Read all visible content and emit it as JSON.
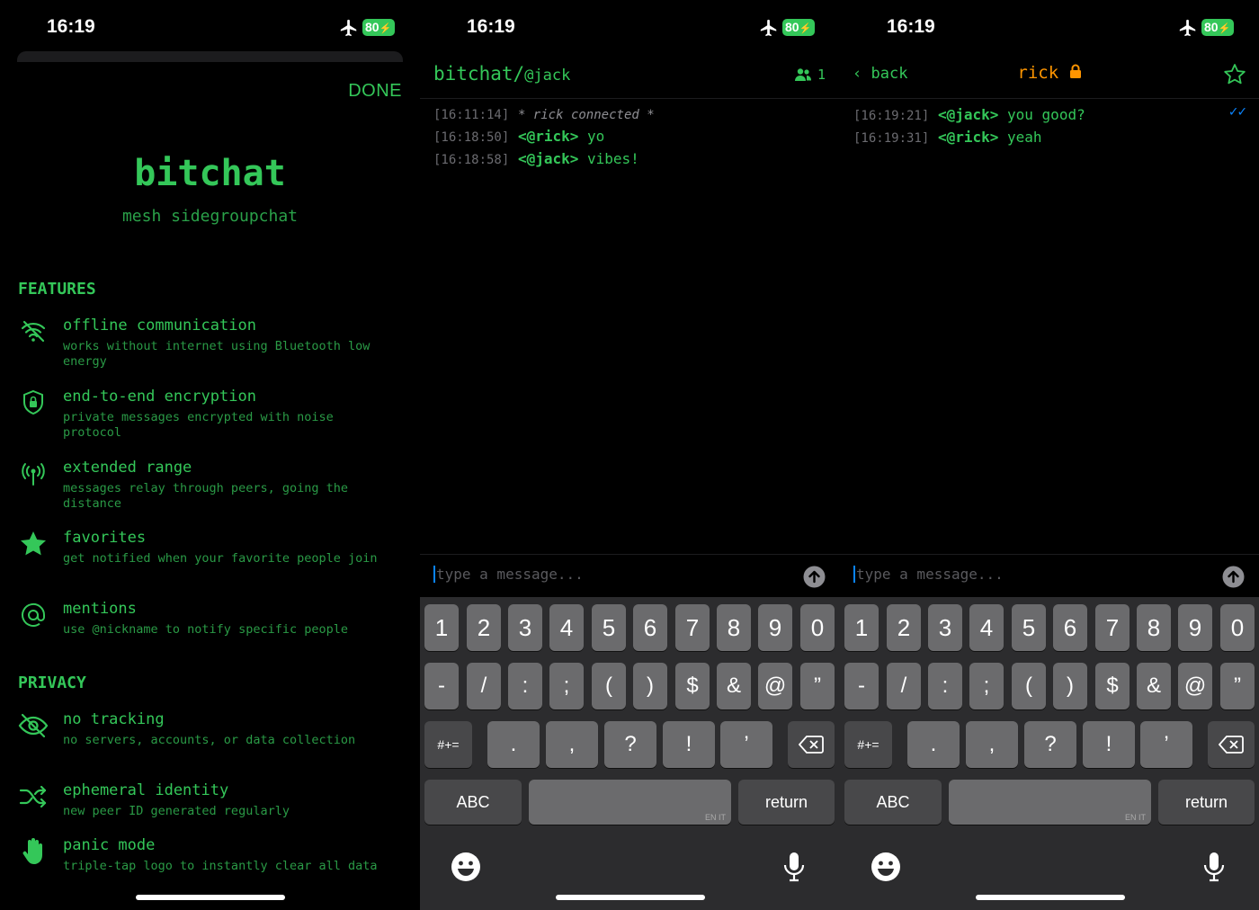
{
  "status_bar": {
    "time": "16:19",
    "battery": "80"
  },
  "about": {
    "done_label": "DONE",
    "title": "bitchat",
    "subtitle": "mesh sidegroupchat",
    "features_heading": "FEATURES",
    "features": [
      {
        "icon": "wifi-slash-icon",
        "title": "offline communication",
        "desc": "works without internet using Bluetooth low energy"
      },
      {
        "icon": "lock-shield-icon",
        "title": "end-to-end encryption",
        "desc": "private messages encrypted with noise protocol"
      },
      {
        "icon": "antenna-icon",
        "title": "extended range",
        "desc": "messages relay through peers, going the distance"
      },
      {
        "icon": "star-icon",
        "title": "favorites",
        "desc": "get notified when your favorite people join"
      },
      {
        "icon": "at-icon",
        "title": "mentions",
        "desc": "use @nickname to notify specific people"
      }
    ],
    "privacy_heading": "PRIVACY",
    "privacy": [
      {
        "icon": "eye-slash-icon",
        "title": "no tracking",
        "desc": "no servers, accounts, or data collection"
      },
      {
        "icon": "shuffle-icon",
        "title": "ephemeral identity",
        "desc": "new peer ID generated regularly"
      },
      {
        "icon": "hand-icon",
        "title": "panic mode",
        "desc": "triple-tap logo to instantly clear all data"
      }
    ]
  },
  "public_chat": {
    "title_prefix": "bitchat/",
    "nickname": "@jack",
    "peer_count": "1",
    "messages": [
      {
        "ts": "[16:11:14]",
        "system": "* rick connected *"
      },
      {
        "ts": "[16:18:50]",
        "sender": "<@rick>",
        "text": "yo"
      },
      {
        "ts": "[16:18:58]",
        "sender": "<@jack>",
        "text": "vibes!"
      }
    ]
  },
  "private_chat": {
    "back_label": "back",
    "peer_name": "rick",
    "messages": [
      {
        "ts": "[16:19:21]",
        "sender": "<@jack>",
        "text": "you good?"
      },
      {
        "ts": "[16:19:31]",
        "sender": "<@rick>",
        "text": "yeah"
      }
    ],
    "read_receipt": "✓✓"
  },
  "input": {
    "placeholder": "type a message..."
  },
  "keyboard": {
    "row1": [
      "1",
      "2",
      "3",
      "4",
      "5",
      "6",
      "7",
      "8",
      "9",
      "0"
    ],
    "row2": [
      "-",
      "/",
      ":",
      ";",
      "(",
      ")",
      "$",
      "&",
      "@",
      "”"
    ],
    "row3": [
      "#+=",
      ".",
      ",",
      "?",
      "!",
      "’"
    ],
    "abc_label": "ABC",
    "return_label": "return",
    "space_lang": "EN IT"
  },
  "colors": {
    "accent": "#34c759",
    "dm_name": "#ff9500",
    "keyboard_bg": "#2c2c2e",
    "key_bg": "#6b6b6d"
  }
}
